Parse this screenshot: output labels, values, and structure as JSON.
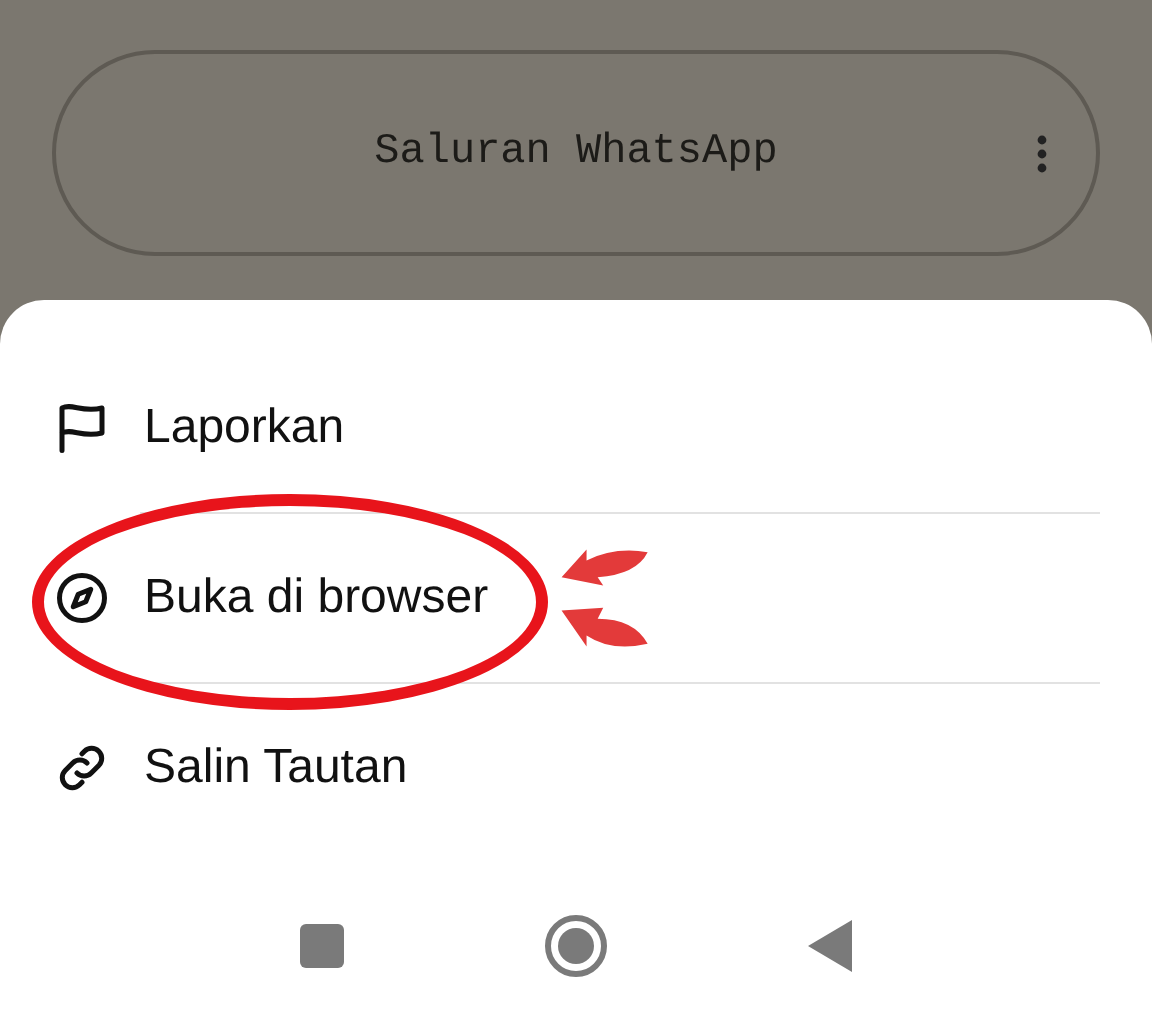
{
  "channel_button": {
    "label": "Saluran WhatsApp"
  },
  "menu": {
    "items": [
      {
        "kind": "flag",
        "label": "Laporkan",
        "highlighted": false
      },
      {
        "kind": "compass",
        "label": "Buka di browser",
        "highlighted": true
      },
      {
        "kind": "link",
        "label": "Salin Tautan",
        "highlighted": false
      }
    ]
  }
}
